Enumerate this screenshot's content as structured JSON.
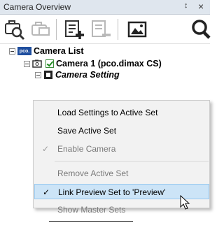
{
  "panel": {
    "title": "Camera Overview",
    "pin_glyph": "p",
    "close_glyph": "×"
  },
  "toolbar": {
    "icons": [
      "camera-search-icon",
      "camera-duplicate-icon",
      "add-set-icon",
      "remove-set-icon",
      "image-preview-icon",
      "zoom-icon"
    ]
  },
  "tree": {
    "root_logo": "pco.",
    "root_label": "Camera List",
    "camera_label": "Camera 1 (pco.dimax CS)",
    "setting_label": "Camera Setting"
  },
  "context_menu": {
    "items": [
      {
        "label": "Load Settings to Active Set",
        "enabled": true,
        "checked": false
      },
      {
        "label": "Save Active Set",
        "enabled": true,
        "checked": false
      },
      {
        "label": "Enable Camera",
        "enabled": false,
        "checked": true
      },
      {
        "label": "Remove Active Set",
        "enabled": false,
        "checked": false
      },
      {
        "label": "Link Preview Set to 'Preview'",
        "enabled": true,
        "checked": true,
        "highlighted": true
      },
      {
        "label": "Show Master Sets",
        "enabled": false,
        "checked": false
      }
    ],
    "check_glyph": "✓"
  }
}
